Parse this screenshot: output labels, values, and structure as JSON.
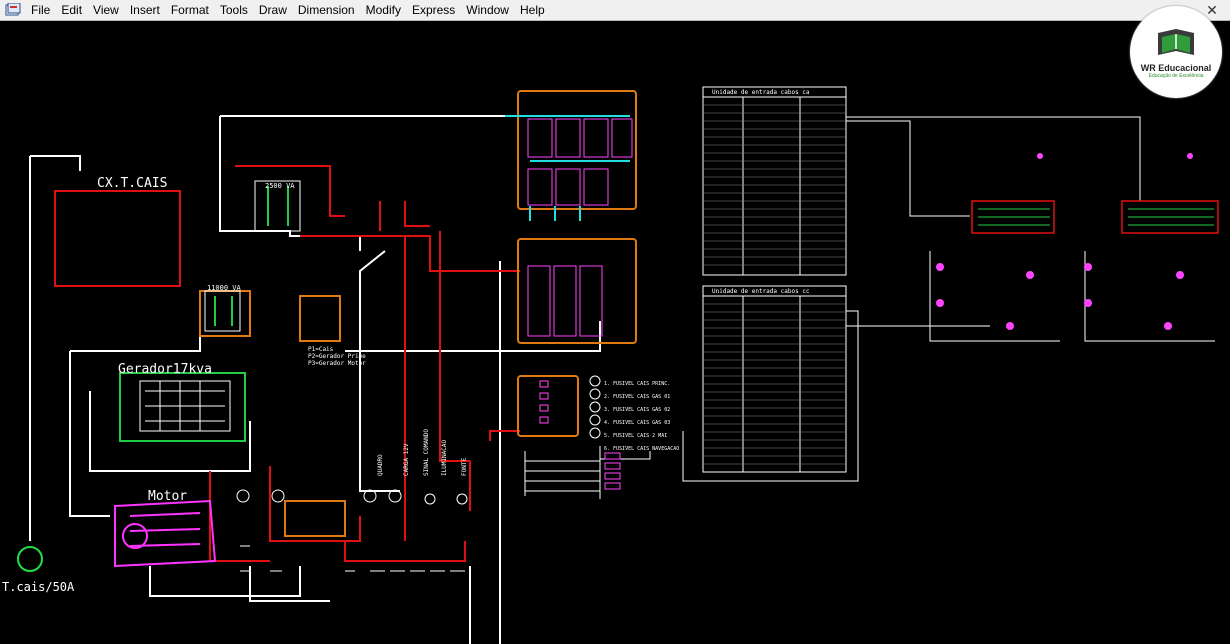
{
  "menu": {
    "items": [
      "File",
      "Edit",
      "View",
      "Insert",
      "Format",
      "Tools",
      "Draw",
      "Dimension",
      "Modify",
      "Express",
      "Window",
      "Help"
    ]
  },
  "watermark": {
    "title": "WR Educacional",
    "subtitle": "Educação de Excelência"
  },
  "drawing": {
    "panel_title": "CX.T.CAIS",
    "generator_label": "Gerador17kva",
    "motor_label": "Motor",
    "cable_label": "T.cais/50A",
    "transformer_small": "2500 VA",
    "transformer_large": "11000 VA",
    "selector_notes": [
      "P1=Cais",
      "P2=Gerador Prime",
      "P3=Gerador Motor"
    ],
    "table_top_title": "Unidade de entrada cabos ca",
    "table_bottom_title": "Unidade de entrada cabos cc",
    "circuit_labels": [
      "1. FUSIVEL CAIS PRINC.",
      "2. FUSIVEL CAIS GAS 01",
      "3. FUSIVEL CAIS GAS 02",
      "4. FUSIVEL CAIS GAS 03",
      "5. FUSIVEL CAIS 2 MAI",
      "6. FUSIVEL CAIS NAVEGACAO"
    ],
    "vertical_labels": [
      "QUADRO",
      "CARGA 12V",
      "SINAL COMANDO",
      "ILUMINACAO",
      "FONTE"
    ],
    "colors": {
      "wire_white": "#ffffff",
      "wire_red": "#e01010",
      "bus_orange": "#e07a10",
      "motor_magenta": "#ff33ff",
      "generator_green": "#22cc44"
    }
  }
}
